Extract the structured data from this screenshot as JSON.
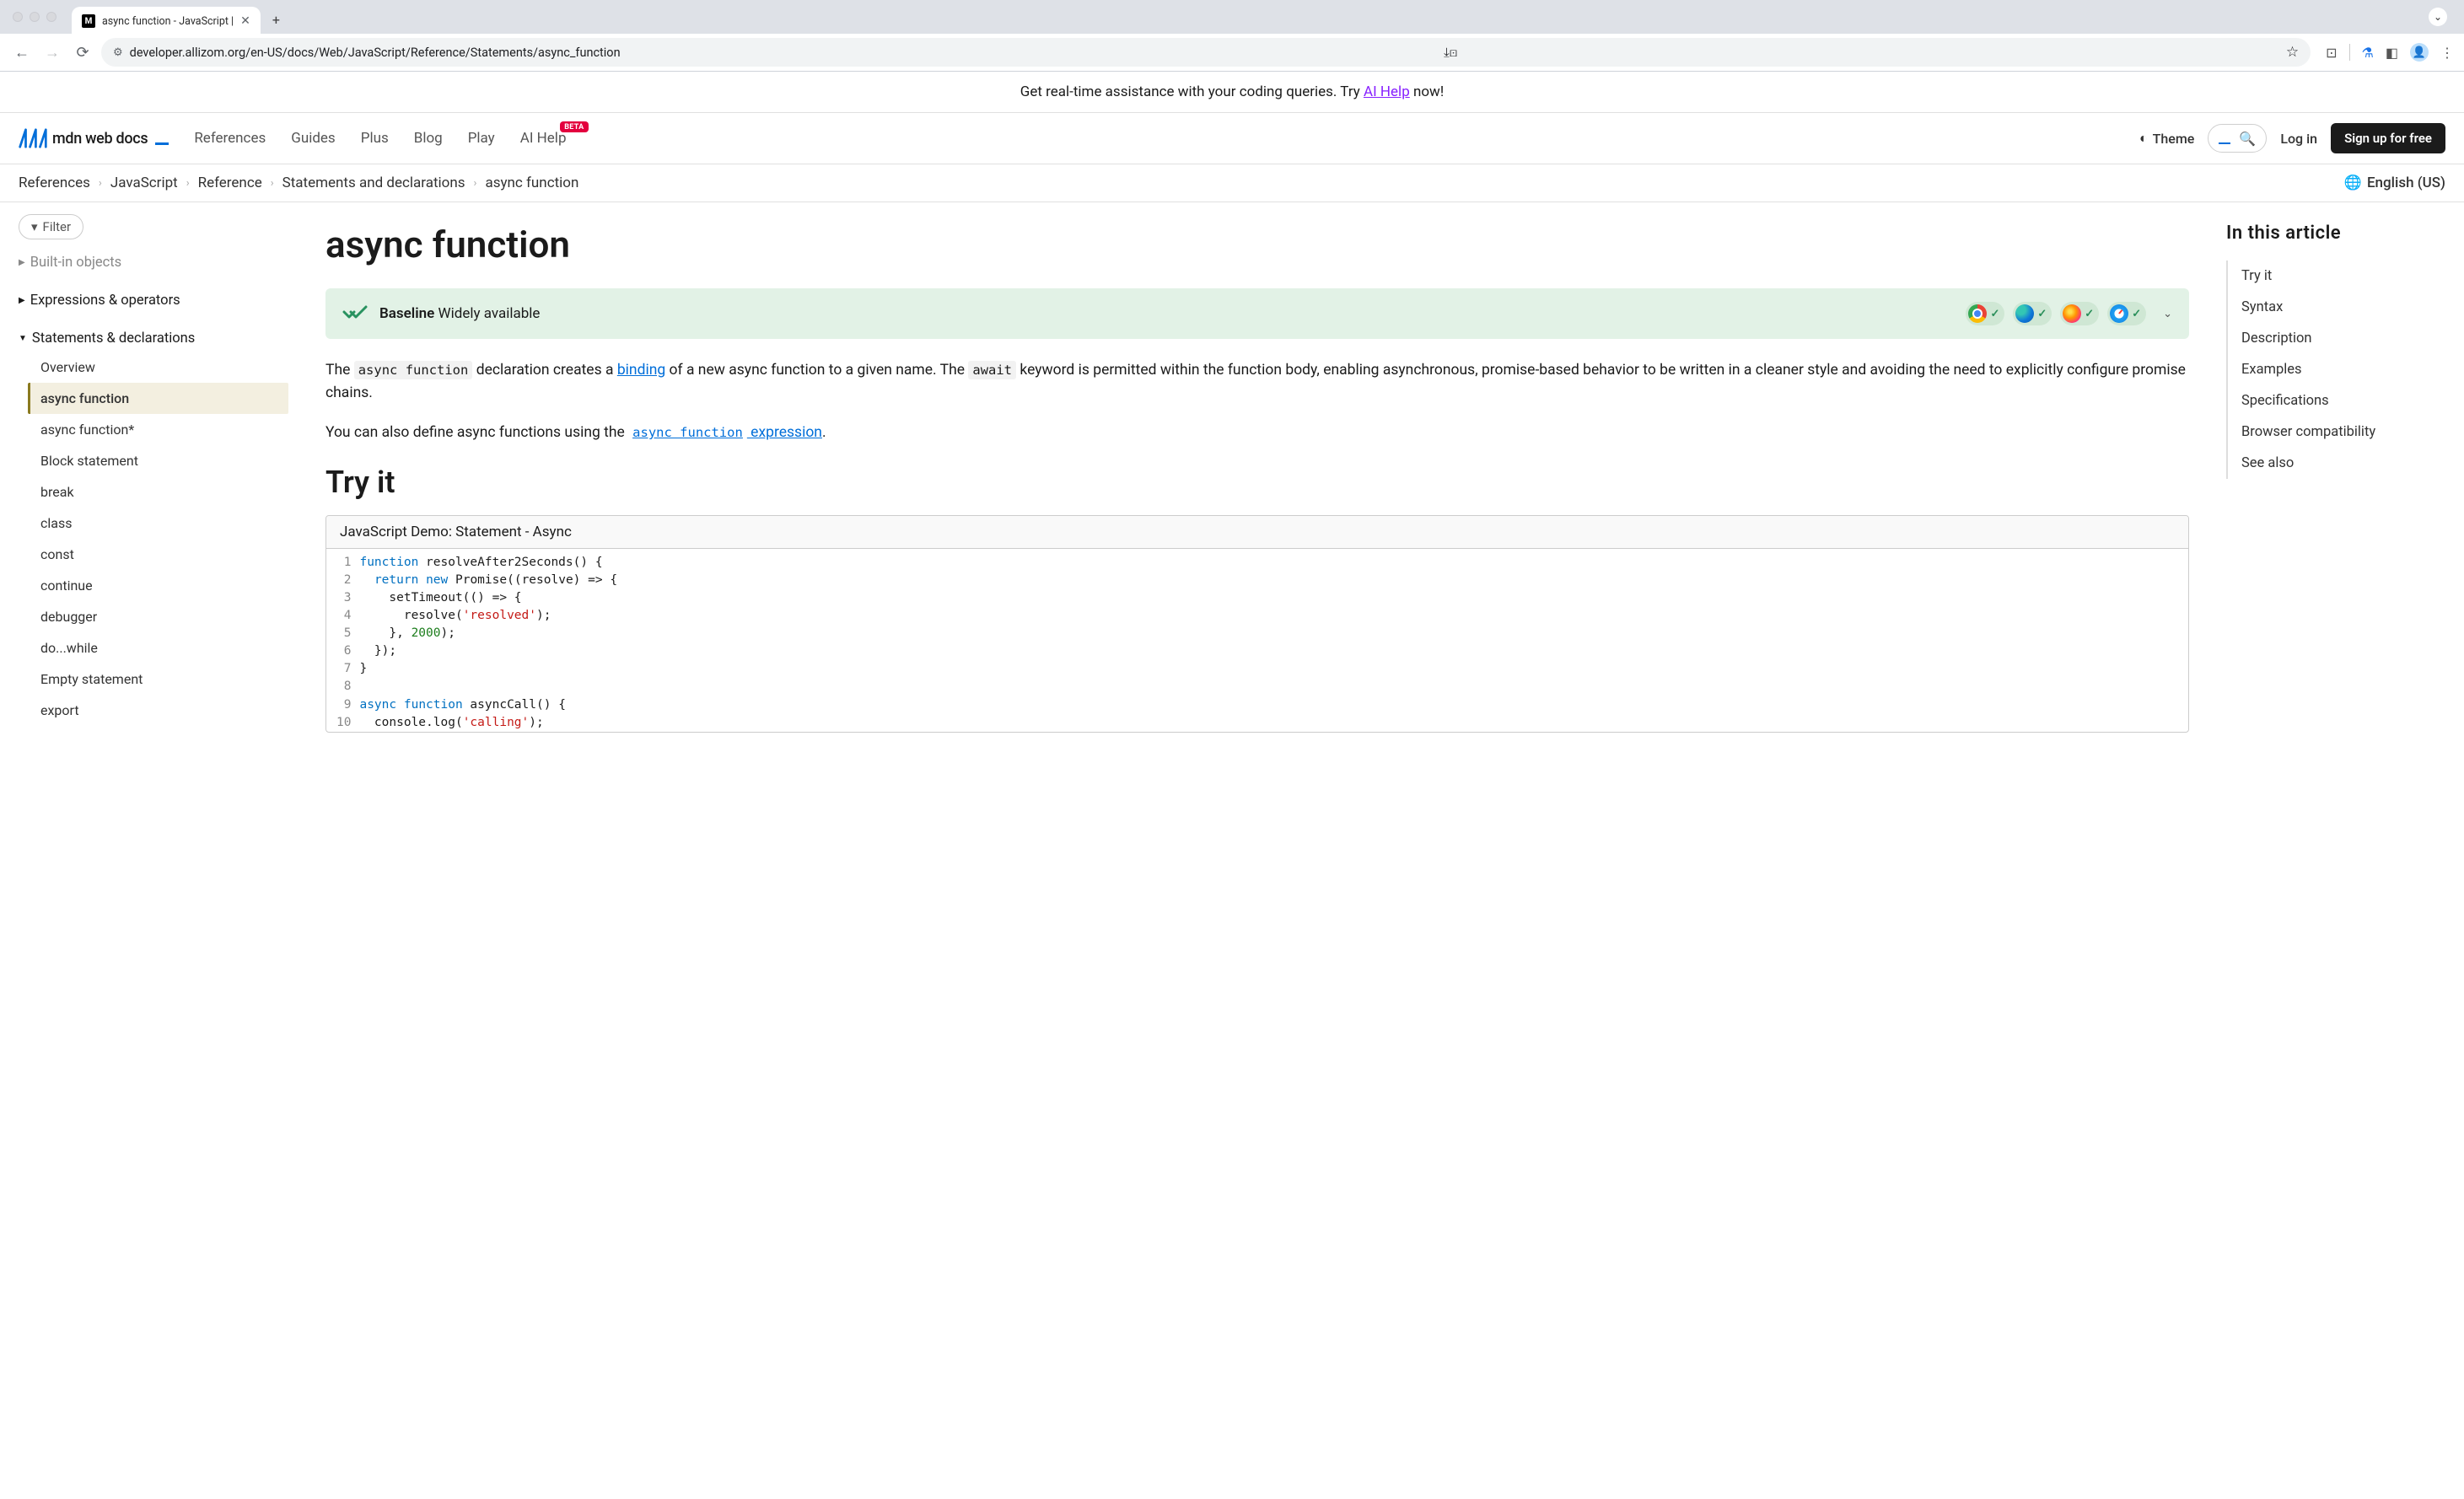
{
  "browser": {
    "tab_title": "async function - JavaScript |",
    "new_tab_tooltip": "+",
    "url": "developer.allizom.org/en-US/docs/Web/JavaScript/Reference/Statements/async_function"
  },
  "promo": {
    "text_a": "Get real-time assistance with your coding queries. Try ",
    "link": "AI Help",
    "text_b": " now!"
  },
  "nav": {
    "logo_text": "mdn web docs",
    "links": [
      "References",
      "Guides",
      "Plus",
      "Blog",
      "Play",
      "AI Help"
    ],
    "beta": "BETA",
    "theme": "Theme",
    "login": "Log in",
    "signup": "Sign up for free"
  },
  "breadcrumb": {
    "items": [
      "References",
      "JavaScript",
      "Reference",
      "Statements and declarations",
      "async function"
    ],
    "lang": "English (US)"
  },
  "sidebar": {
    "filter": "Filter",
    "group_faded": "Built-in objects",
    "group_expr": "Expressions & operators",
    "group_stmt": "Statements & declarations",
    "items": [
      "Overview",
      "async function",
      "async function*",
      "Block statement",
      "break",
      "class",
      "const",
      "continue",
      "debugger",
      "do...while",
      "Empty statement",
      "export"
    ]
  },
  "article": {
    "title": "async function",
    "baseline_strong": "Baseline",
    "baseline_rest": " Widely available",
    "p1_a": "The ",
    "p1_code1": "async function",
    "p1_b": " declaration creates a ",
    "p1_link1": "binding",
    "p1_c": " of a new async function to a given name. The ",
    "p1_code2": "await",
    "p1_d": " keyword is permitted within the function body, enabling asynchronous, promise-based behavior to be written in a cleaner style and avoiding the need to explicitly configure promise chains.",
    "p2_a": "You can also define async functions using the ",
    "p2_linkcode": "async function",
    "p2_linktext": " expression",
    "p2_b": ".",
    "h2_tryit": "Try it",
    "demo_title": "JavaScript Demo: Statement - Async",
    "code_lines": [
      {
        "n": 1,
        "html": "<span class='kw'>function</span> resolveAfter2Seconds() {"
      },
      {
        "n": 2,
        "html": "  <span class='kw'>return</span> <span class='kw'>new</span> Promise((resolve) =&gt; {"
      },
      {
        "n": 3,
        "html": "    setTimeout(() =&gt; {"
      },
      {
        "n": 4,
        "html": "      resolve(<span class='str'>'resolved'</span>);"
      },
      {
        "n": 5,
        "html": "    }, <span class='num'>2000</span>);"
      },
      {
        "n": 6,
        "html": "  });"
      },
      {
        "n": 7,
        "html": "}"
      },
      {
        "n": 8,
        "html": ""
      },
      {
        "n": 9,
        "html": "<span class='kw'>async</span> <span class='kw'>function</span> asyncCall() {"
      },
      {
        "n": 10,
        "html": "  console.log(<span class='str'>'calling'</span>);"
      }
    ]
  },
  "toc": {
    "heading": "In this article",
    "items": [
      "Try it",
      "Syntax",
      "Description",
      "Examples",
      "Specifications",
      "Browser compatibility",
      "See also"
    ]
  }
}
